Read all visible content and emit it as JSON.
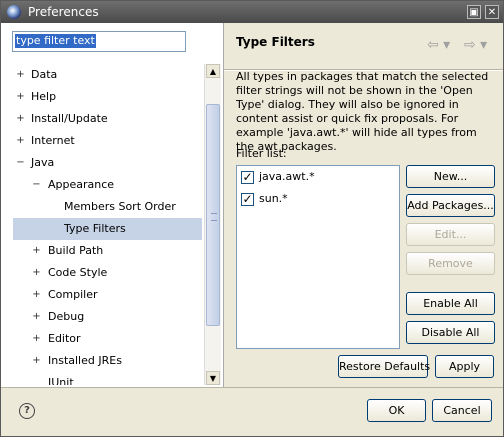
{
  "window": {
    "title": "Preferences"
  },
  "title_buttons": {
    "restore": "▣",
    "close": "✕"
  },
  "filter_text": "type filter text",
  "tree": [
    {
      "label": "Data",
      "toggle": "+",
      "level": 0
    },
    {
      "label": "Help",
      "toggle": "+",
      "level": 0
    },
    {
      "label": "Install/Update",
      "toggle": "+",
      "level": 0
    },
    {
      "label": "Internet",
      "toggle": "+",
      "level": 0
    },
    {
      "label": "Java",
      "toggle": "−",
      "level": 0
    },
    {
      "label": "Appearance",
      "toggle": "−",
      "level": 1
    },
    {
      "label": "Members Sort Order",
      "toggle": "",
      "level": 2
    },
    {
      "label": "Type Filters",
      "toggle": "",
      "level": 2,
      "selected": true
    },
    {
      "label": "Build Path",
      "toggle": "+",
      "level": 1
    },
    {
      "label": "Code Style",
      "toggle": "+",
      "level": 1
    },
    {
      "label": "Compiler",
      "toggle": "+",
      "level": 1
    },
    {
      "label": "Debug",
      "toggle": "+",
      "level": 1
    },
    {
      "label": "Editor",
      "toggle": "+",
      "level": 1
    },
    {
      "label": "Installed JREs",
      "toggle": "+",
      "level": 1
    },
    {
      "label": "JUnit",
      "toggle": "",
      "level": 1
    }
  ],
  "page": {
    "title": "Type Filters",
    "back_glyph": "⇦ ▾",
    "forward_glyph": "⇨ ▾",
    "description": "All types in packages that match the selected filter strings will not be shown in the 'Open Type' dialog. They will also be ignored in content assist or quick fix proposals. For example 'java.awt.*' will hide all types from the awt packages.",
    "filter_list_label": "Filter list:",
    "filters": [
      {
        "label": "java.awt.*",
        "checked": true
      },
      {
        "label": "sun.*",
        "checked": true
      }
    ],
    "buttons": {
      "new": "New...",
      "add_packages": "Add Packages...",
      "edit": "Edit...",
      "remove": "Remove",
      "enable_all": "Enable All",
      "disable_all": "Disable All",
      "restore_defaults": "Restore Defaults",
      "apply": "Apply"
    }
  },
  "footer": {
    "help_glyph": "?",
    "ok": "OK",
    "cancel": "Cancel"
  }
}
